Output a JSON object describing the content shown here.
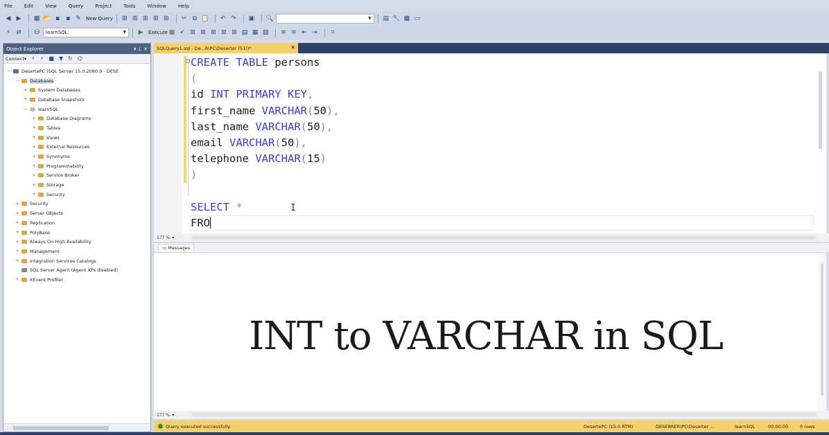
{
  "menu": [
    "File",
    "Edit",
    "View",
    "Query",
    "Project",
    "Tools",
    "Window",
    "Help"
  ],
  "toolbar": {
    "new_query_label": "New Query",
    "database": "learnSQL",
    "execute_label": "Execute"
  },
  "object_explorer": {
    "title": "Object Explorer",
    "connect_label": "Connect",
    "tree": [
      {
        "label": "DesertePC (SQL Server 15.0.2080.9 - DESE",
        "level": 0,
        "expander": "−",
        "icon": "server"
      },
      {
        "label": "Databases",
        "level": 1,
        "expander": "−",
        "icon": "folder",
        "selected": true
      },
      {
        "label": "System Databases",
        "level": 2,
        "expander": "+",
        "icon": "folder"
      },
      {
        "label": "Database Snapshots",
        "level": 2,
        "expander": "+",
        "icon": "folder"
      },
      {
        "label": "learnSQL",
        "level": 2,
        "expander": "−",
        "icon": "database"
      },
      {
        "label": "Database Diagrams",
        "level": 3,
        "expander": "+",
        "icon": "folder"
      },
      {
        "label": "Tables",
        "level": 3,
        "expander": "+",
        "icon": "folder"
      },
      {
        "label": "Views",
        "level": 3,
        "expander": "+",
        "icon": "folder"
      },
      {
        "label": "External Resources",
        "level": 3,
        "expander": "+",
        "icon": "folder"
      },
      {
        "label": "Synonyms",
        "level": 3,
        "expander": "+",
        "icon": "folder"
      },
      {
        "label": "Programmability",
        "level": 3,
        "expander": "+",
        "icon": "folder"
      },
      {
        "label": "Service Broker",
        "level": 3,
        "expander": "+",
        "icon": "folder"
      },
      {
        "label": "Storage",
        "level": 3,
        "expander": "+",
        "icon": "folder"
      },
      {
        "label": "Security",
        "level": 3,
        "expander": "+",
        "icon": "folder"
      },
      {
        "label": "Security",
        "level": 1,
        "expander": "+",
        "icon": "folder"
      },
      {
        "label": "Server Objects",
        "level": 1,
        "expander": "+",
        "icon": "folder"
      },
      {
        "label": "Replication",
        "level": 1,
        "expander": "+",
        "icon": "folder"
      },
      {
        "label": "PolyBase",
        "level": 1,
        "expander": "+",
        "icon": "folder"
      },
      {
        "label": "Always On High Availability",
        "level": 1,
        "expander": "+",
        "icon": "folder"
      },
      {
        "label": "Management",
        "level": 1,
        "expander": "+",
        "icon": "folder"
      },
      {
        "label": "Integration Services Catalogs",
        "level": 1,
        "expander": "+",
        "icon": "folder"
      },
      {
        "label": "SQL Server Agent (Agent XPs disabled)",
        "level": 1,
        "expander": "",
        "icon": "agent"
      },
      {
        "label": "XEvent Profiler",
        "level": 1,
        "expander": "+",
        "icon": "folder"
      }
    ]
  },
  "editor": {
    "tab_label": "SQLQuery1.sql - De...R\\PC\\Deserter (51))*",
    "zoom": "177 %",
    "code_lines": [
      [
        {
          "t": "CREATE TABLE",
          "c": "kw"
        },
        {
          "t": " persons",
          "c": ""
        }
      ],
      [
        {
          "t": "(",
          "c": "pn"
        }
      ],
      [
        {
          "t": "id ",
          "c": ""
        },
        {
          "t": "INT PRIMARY KEY",
          "c": "kw"
        },
        {
          "t": ",",
          "c": "pn"
        }
      ],
      [
        {
          "t": "first_name ",
          "c": ""
        },
        {
          "t": "VARCHAR",
          "c": "kw"
        },
        {
          "t": "(",
          "c": "pn"
        },
        {
          "t": "50",
          "c": ""
        },
        {
          "t": "),",
          "c": "pn"
        }
      ],
      [
        {
          "t": "last_name ",
          "c": ""
        },
        {
          "t": "VARCHAR",
          "c": "kw"
        },
        {
          "t": "(",
          "c": "pn"
        },
        {
          "t": "50",
          "c": ""
        },
        {
          "t": "),",
          "c": "pn"
        }
      ],
      [
        {
          "t": "email ",
          "c": ""
        },
        {
          "t": "VARCHAR",
          "c": "kw"
        },
        {
          "t": "(",
          "c": "pn"
        },
        {
          "t": "50",
          "c": ""
        },
        {
          "t": "),",
          "c": "pn"
        }
      ],
      [
        {
          "t": "telephone ",
          "c": ""
        },
        {
          "t": "VARCHAR",
          "c": "kw"
        },
        {
          "t": "(",
          "c": "pn"
        },
        {
          "t": "15",
          "c": ""
        },
        {
          "t": ")",
          "c": "pn"
        }
      ],
      [
        {
          "t": ")",
          "c": "pn"
        }
      ],
      [],
      [
        {
          "t": "SELECT",
          "c": "kw"
        },
        {
          "t": " *",
          "c": "pn"
        }
      ],
      [
        {
          "t": "FRO",
          "c": ""
        }
      ]
    ]
  },
  "results": {
    "tab_label": "Messages",
    "overlay_title": "INT to VARCHAR in SQL",
    "zoom": "177 %"
  },
  "status": {
    "message": "Query executed successfully.",
    "server": "DesertePC (15.0 RTM)",
    "user": "DESERRER\\PC\\Deserter ...",
    "database": "learnSQL",
    "time": "00:00:00",
    "rows": "0 rows"
  },
  "colors": {
    "status_bar": "#f5cf6a",
    "keyword": "#3b3bd6",
    "title_bar": "#4d6082"
  }
}
